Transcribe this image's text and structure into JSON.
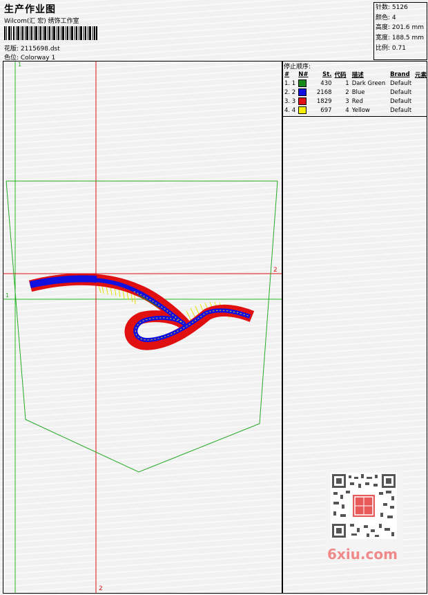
{
  "header": {
    "title": "生产作业图",
    "subtitle": "Wilcom(汇 宏) 绣饰工作室",
    "design_label": "花版: 2115698.dst",
    "colorway_label": "色位: Colorway 1"
  },
  "stats": {
    "stitches": "针数: 5126",
    "colors": "颜色: 4",
    "height": "高度: 201.6 mm",
    "width": "宽度: 188.5 mm",
    "scale": "比例: 0.71"
  },
  "stop_sequence": {
    "title": "停止顺序:",
    "headers": [
      "#",
      "N#",
      "St.",
      "代码",
      "描述",
      "Brand",
      "元素"
    ],
    "rows": [
      {
        "idx": "1. 1",
        "count": "430",
        "code": "1",
        "desc": "Dark Green",
        "brand": "Default",
        "color": "#1a8a1a"
      },
      {
        "idx": "2. 2",
        "count": "2168",
        "code": "2",
        "desc": "Blue",
        "brand": "Default",
        "color": "#1010e0"
      },
      {
        "idx": "3. 3",
        "count": "1829",
        "code": "3",
        "desc": "Red",
        "brand": "Default",
        "color": "#e01010"
      },
      {
        "idx": "4. 4",
        "count": "697",
        "code": "4",
        "desc": "Yellow",
        "brand": "Default",
        "color": "#f5f000"
      }
    ]
  },
  "rulers": {
    "green_top": "1",
    "green_left": "1",
    "red_right": "2",
    "red_bottom": "2"
  },
  "watermark": "6xiu.com",
  "colors": {
    "guide_green": "#22bb22",
    "guide_red": "#dd1111",
    "pocket_outline": "#22aa22"
  }
}
